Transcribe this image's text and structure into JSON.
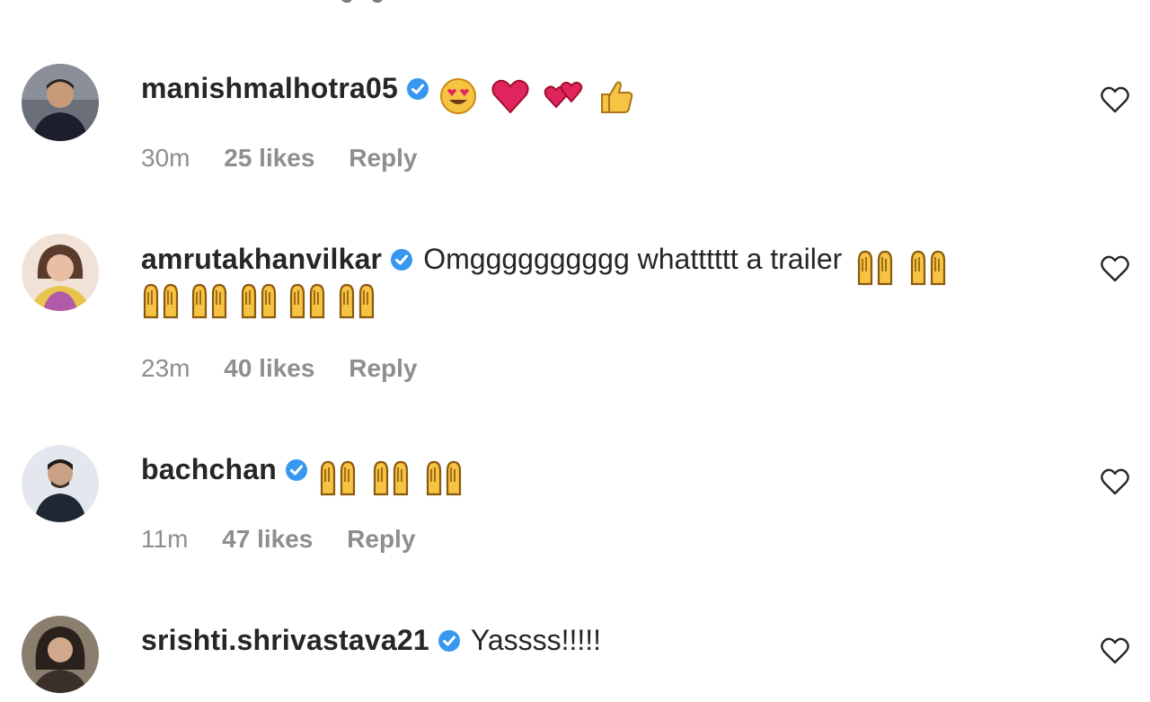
{
  "comments": [
    {
      "username": "manishmalhotra05",
      "verified": true,
      "text": "",
      "emojis": [
        "smiling-face-with-heart-eyes",
        "red-heart",
        "two-hearts",
        "thumbs-up"
      ],
      "time": "30m",
      "likes": "25 likes",
      "reply": "Reply"
    },
    {
      "username": "amrutakhanvilkar",
      "verified": true,
      "text": "Omgggggggggg whatttttt a trailer",
      "emojis": [
        "raising-hands",
        "raising-hands",
        "raising-hands",
        "raising-hands",
        "raising-hands",
        "raising-hands",
        "raising-hands"
      ],
      "time": "23m",
      "likes": "40 likes",
      "reply": "Reply"
    },
    {
      "username": "bachchan",
      "verified": true,
      "text": "",
      "emojis": [
        "raising-hands",
        "raising-hands",
        "raising-hands"
      ],
      "time": "11m",
      "likes": "47 likes",
      "reply": "Reply"
    },
    {
      "username": "srishti.shrivastava21",
      "verified": true,
      "text": "Yassss!!!!!",
      "emojis": [],
      "time": "",
      "likes": "",
      "reply": ""
    }
  ],
  "colors": {
    "verified_blue": "#3897f0",
    "meta_grey": "#8e8e8e",
    "text": "#262626",
    "emoji_yellow": "#f6c343",
    "heart_red": "#e0245e"
  }
}
